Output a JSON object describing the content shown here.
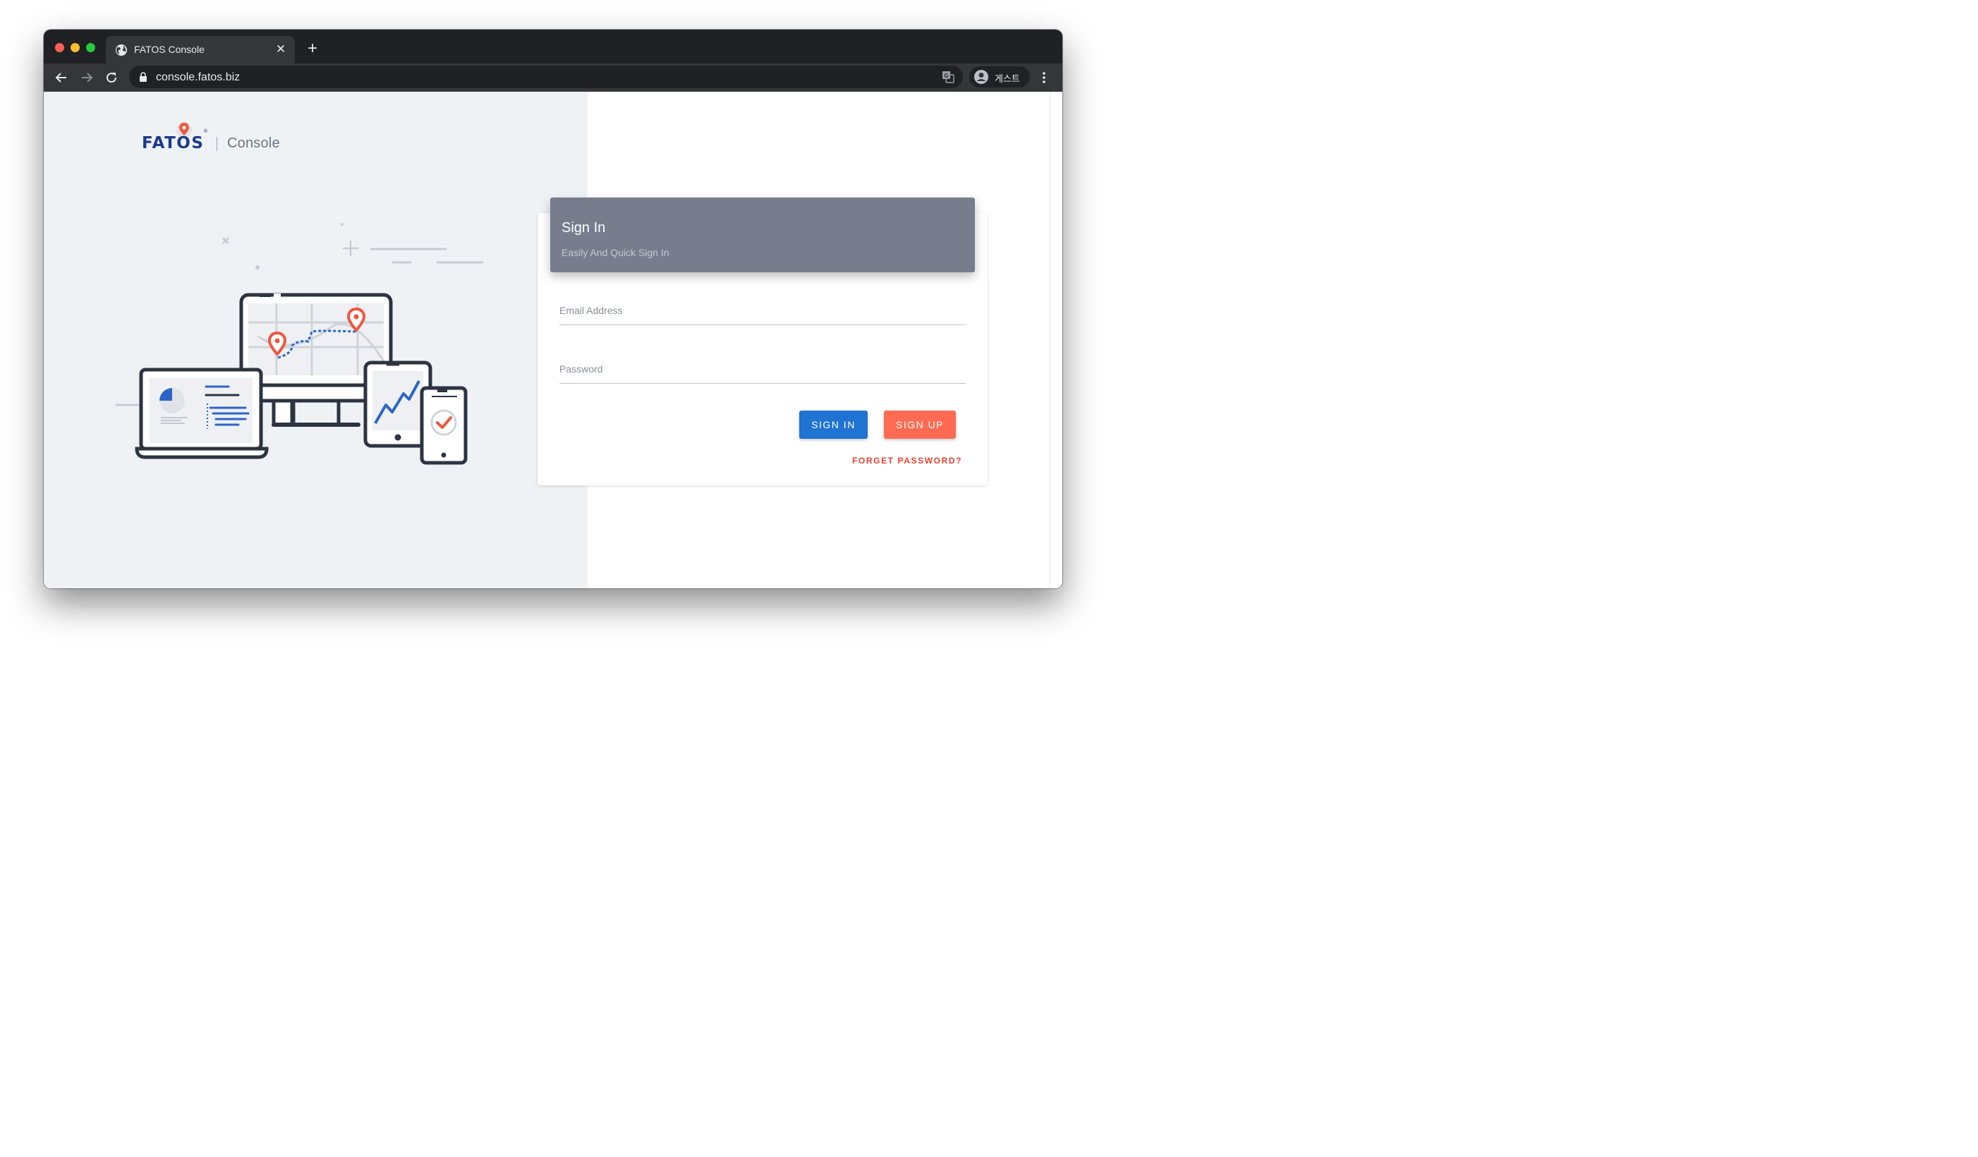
{
  "browser": {
    "tab_title": "FATOS Console",
    "url": "console.fatos.biz",
    "profile_name": "게스트"
  },
  "brand": {
    "logo_text": "FATOS",
    "product_name": "Console",
    "colors": {
      "logo_blue": "#1b3a8c",
      "pin_orange": "#f0563d",
      "panel_bg": "#eff2f5"
    }
  },
  "signin": {
    "title": "Sign In",
    "subtitle": "Easily And Quick Sign In",
    "email_label": "Email Address",
    "password_label": "Password",
    "signin_button": "SIGN IN",
    "signup_button": "SIGN UP",
    "forget_password": "FORGET PASSWORD?",
    "colors": {
      "header_bg": "#777d8d",
      "signin_bg": "#1f73d2",
      "signup_bg": "#ff6b52",
      "forget_text": "#ee3f2c"
    }
  },
  "icons": [
    "globe-icon",
    "close-icon",
    "plus-icon",
    "back-arrow-icon",
    "forward-arrow-icon",
    "reload-icon",
    "lock-icon",
    "translate-icon",
    "avatar-icon",
    "more-vert-icon"
  ]
}
